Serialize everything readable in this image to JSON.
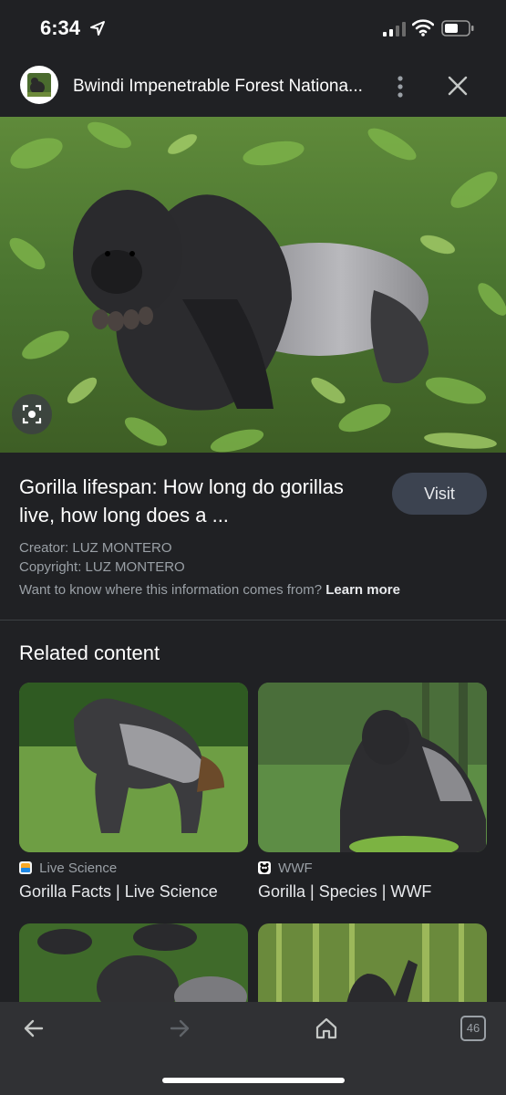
{
  "status_bar": {
    "time": "6:34"
  },
  "header": {
    "title": "Bwindi Impenetrable Forest Nationa...",
    "favicon_icon": "gorilla-thumbnail-icon",
    "menu_icon": "more-vertical-icon",
    "close_icon": "close-icon"
  },
  "hero": {
    "lens_icon": "google-lens-icon"
  },
  "result": {
    "title": "Gorilla lifespan: How long do gorillas live, how long does a ...",
    "visit_label": "Visit",
    "creator": "Creator: LUZ MONTERO",
    "copyright": "Copyright: LUZ MONTERO",
    "info_text": "Want to know where this information comes from?",
    "learn_more": "Learn more"
  },
  "related": {
    "heading": "Related content",
    "items": [
      {
        "source": "Live Science",
        "title": "Gorilla Facts | Live Science"
      },
      {
        "source": "WWF",
        "title": "Gorilla | Species | WWF"
      }
    ]
  },
  "toolbar": {
    "back_icon": "back-arrow-icon",
    "forward_icon": "forward-arrow-icon",
    "home_icon": "home-icon",
    "tabs_count": "46"
  }
}
